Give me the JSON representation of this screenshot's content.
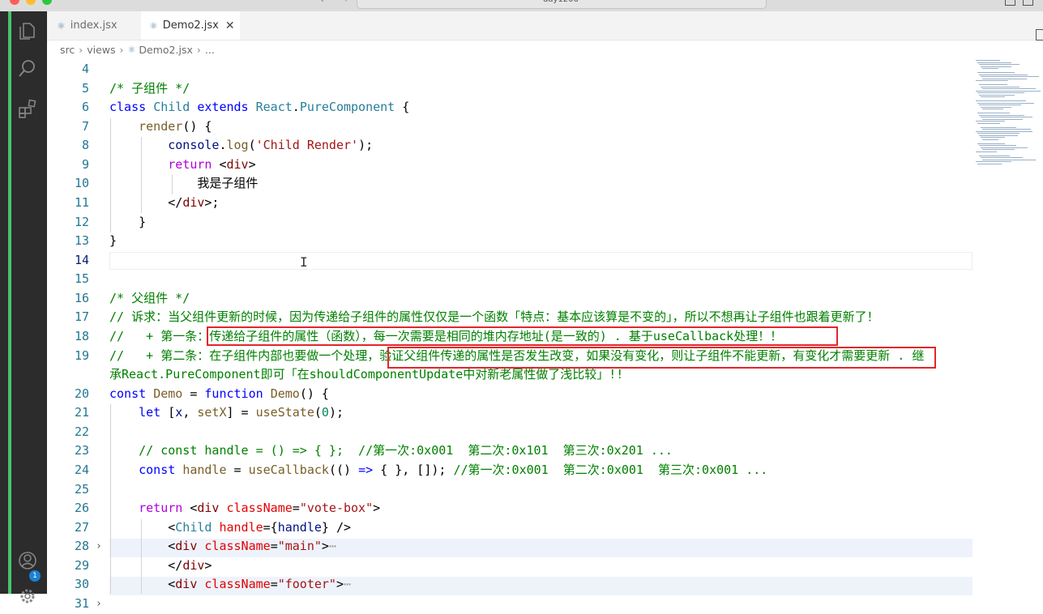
{
  "window": {
    "search_text": "day1206"
  },
  "activity_bar": {
    "icons": [
      "files-icon",
      "search-icon",
      "extensions-icon",
      "account-icon",
      "settings-icon"
    ],
    "badge_count": "1"
  },
  "tabs": [
    {
      "label": "index.jsx",
      "active": false
    },
    {
      "label": "Demo2.jsx",
      "active": true,
      "close": "✕"
    }
  ],
  "breadcrumb": {
    "items": [
      "src",
      "views",
      "Demo2.jsx",
      "..."
    ]
  },
  "editor": {
    "line_numbers": [
      "4",
      "5",
      "6",
      "7",
      "8",
      "9",
      "10",
      "11",
      "12",
      "13",
      "14",
      "15",
      "16",
      "17",
      "18",
      "19",
      "",
      "20",
      "21",
      "22",
      "23",
      "24",
      "25",
      "26",
      "27",
      "28",
      "29",
      "30",
      "31"
    ],
    "current_line": "14",
    "lines": [
      [],
      [
        [
          "cmt",
          "/* 子组件 */"
        ]
      ],
      [
        [
          "kw",
          "class"
        ],
        [
          "t",
          " "
        ],
        [
          "cls",
          "Child"
        ],
        [
          "t",
          " "
        ],
        [
          "kw",
          "extends"
        ],
        [
          "t",
          " "
        ],
        [
          "cls",
          "React"
        ],
        [
          "t",
          "."
        ],
        [
          "cls",
          "PureComponent"
        ],
        [
          "t",
          " {"
        ]
      ],
      [
        [
          "t",
          "    "
        ],
        [
          "fn",
          "render"
        ],
        [
          "t",
          "() {"
        ]
      ],
      [
        [
          "t",
          "        "
        ],
        [
          "var",
          "console"
        ],
        [
          "t",
          "."
        ],
        [
          "fn",
          "log"
        ],
        [
          "t",
          "("
        ],
        [
          "str",
          "'Child Render'"
        ],
        [
          "t",
          ");"
        ]
      ],
      [
        [
          "t",
          "        "
        ],
        [
          "ctl",
          "return"
        ],
        [
          "t",
          " <"
        ],
        [
          "tag",
          "div"
        ],
        [
          "t",
          ">"
        ]
      ],
      [
        [
          "t",
          "            我是子组件"
        ]
      ],
      [
        [
          "t",
          "        </"
        ],
        [
          "tag",
          "div"
        ],
        [
          "t",
          ">;"
        ]
      ],
      [
        [
          "t",
          "    }"
        ]
      ],
      [
        [
          "t",
          "}"
        ]
      ],
      [],
      [],
      [
        [
          "cmt",
          "/* 父组件 */"
        ]
      ],
      [
        [
          "cmt",
          "// 诉求：当父组件更新的时候，因为传递给子组件的属性仅仅是一个函数「特点：基本应该算是不变的」，所以不想再让子组件也跟着更新了！"
        ]
      ],
      [
        [
          "cmt",
          "//   + 第一条：传递给子组件的属性（函数），每一次需要是相同的堆内存地址(是一致的) . 基于useCallback处理！！"
        ]
      ],
      [
        [
          "cmt",
          "//   + 第二条：在子组件内部也要做一个处理，验证父组件传递的属性是否发生改变，如果没有变化，则让子组件不能更新，有变化才需要更新 . 继"
        ]
      ],
      [
        [
          "cmt",
          "承React.PureComponent即可「在shouldComponentUpdate中对新老属性做了浅比较」!!"
        ]
      ],
      [
        [
          "kw",
          "const"
        ],
        [
          "t",
          " "
        ],
        [
          "fn",
          "Demo"
        ],
        [
          "t",
          " = "
        ],
        [
          "kw",
          "function"
        ],
        [
          "t",
          " "
        ],
        [
          "fn",
          "Demo"
        ],
        [
          "t",
          "() {"
        ]
      ],
      [
        [
          "t",
          "    "
        ],
        [
          "kw",
          "let"
        ],
        [
          "t",
          " ["
        ],
        [
          "var",
          "x"
        ],
        [
          "t",
          ", "
        ],
        [
          "fn",
          "setX"
        ],
        [
          "t",
          "] = "
        ],
        [
          "fn",
          "useState"
        ],
        [
          "t",
          "("
        ],
        [
          "num",
          "0"
        ],
        [
          "t",
          ");"
        ]
      ],
      [],
      [
        [
          "t",
          "    "
        ],
        [
          "cmt",
          "// const handle = () => { };  //第一次:0x001  第二次:0x101  第三次:0x201 ..."
        ]
      ],
      [
        [
          "t",
          "    "
        ],
        [
          "kw",
          "const"
        ],
        [
          "t",
          " "
        ],
        [
          "fn",
          "handle"
        ],
        [
          "t",
          " = "
        ],
        [
          "fn",
          "useCallback"
        ],
        [
          "t",
          "(() "
        ],
        [
          "kw",
          "=>"
        ],
        [
          "t",
          " { }, []); "
        ],
        [
          "cmt",
          "//第一次:0x001  第二次:0x001  第三次:0x001 ..."
        ]
      ],
      [],
      [
        [
          "t",
          "    "
        ],
        [
          "ctl",
          "return"
        ],
        [
          "t",
          " <"
        ],
        [
          "tag",
          "div"
        ],
        [
          "t",
          " "
        ],
        [
          "attr",
          "className"
        ],
        [
          "t",
          "="
        ],
        [
          "str",
          "\"vote-box\""
        ],
        [
          "t",
          ">"
        ]
      ],
      [
        [
          "t",
          "        <"
        ],
        [
          "cls",
          "Child"
        ],
        [
          "t",
          " "
        ],
        [
          "attr",
          "handle"
        ],
        [
          "t",
          "={"
        ],
        [
          "var",
          "handle"
        ],
        [
          "t",
          "} />"
        ]
      ],
      [
        [
          "t",
          "        <"
        ],
        [
          "tag",
          "div"
        ],
        [
          "t",
          " "
        ],
        [
          "attr",
          "className"
        ],
        [
          "t",
          "="
        ],
        [
          "str",
          "\"main\""
        ],
        [
          "t",
          ">"
        ],
        [
          "ell",
          "⋯"
        ]
      ],
      [
        [
          "t",
          "        </"
        ],
        [
          "tag",
          "div"
        ],
        [
          "t",
          ">"
        ]
      ],
      [
        [
          "t",
          "        <"
        ],
        [
          "tag",
          "div"
        ],
        [
          "t",
          " "
        ],
        [
          "attr",
          "className"
        ],
        [
          "t",
          "="
        ],
        [
          "str",
          "\"footer\""
        ],
        [
          "t",
          ">"
        ],
        [
          "ell",
          "⋯"
        ]
      ]
    ]
  }
}
